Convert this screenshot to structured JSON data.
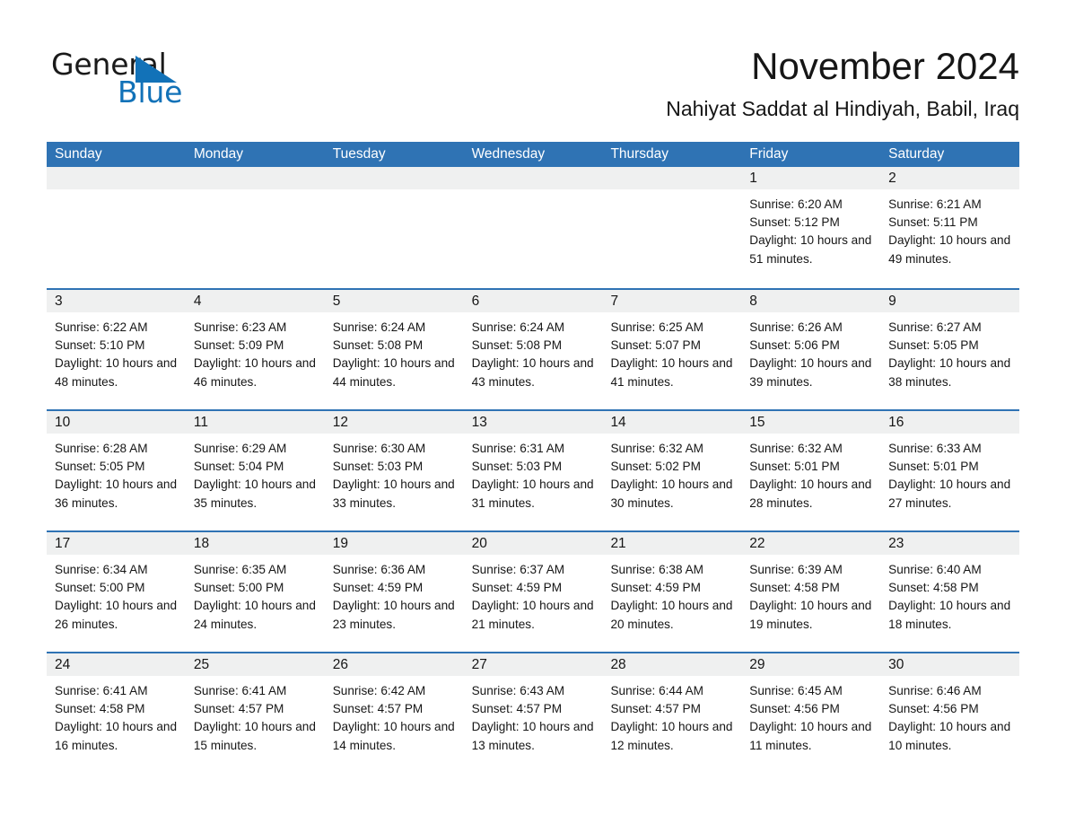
{
  "brand": {
    "name_part1": "General",
    "name_part2": "Blue",
    "triangle_color": "#1272b8"
  },
  "header": {
    "title": "November 2024",
    "subtitle": "Nahiyat Saddat al Hindiyah, Babil, Iraq"
  },
  "theme": {
    "header_blue": "#2f73b4",
    "day_band_gray": "#eff0f0",
    "text_color": "#161616"
  },
  "weekdays": [
    "Sunday",
    "Monday",
    "Tuesday",
    "Wednesday",
    "Thursday",
    "Friday",
    "Saturday"
  ],
  "weeks": [
    [
      {
        "day": "",
        "sunrise": "",
        "sunset": "",
        "daylight": "",
        "empty": true
      },
      {
        "day": "",
        "sunrise": "",
        "sunset": "",
        "daylight": "",
        "empty": true
      },
      {
        "day": "",
        "sunrise": "",
        "sunset": "",
        "daylight": "",
        "empty": true
      },
      {
        "day": "",
        "sunrise": "",
        "sunset": "",
        "daylight": "",
        "empty": true
      },
      {
        "day": "",
        "sunrise": "",
        "sunset": "",
        "daylight": "",
        "empty": true
      },
      {
        "day": "1",
        "sunrise": "Sunrise: 6:20 AM",
        "sunset": "Sunset: 5:12 PM",
        "daylight": "Daylight: 10 hours and 51 minutes."
      },
      {
        "day": "2",
        "sunrise": "Sunrise: 6:21 AM",
        "sunset": "Sunset: 5:11 PM",
        "daylight": "Daylight: 10 hours and 49 minutes."
      }
    ],
    [
      {
        "day": "3",
        "sunrise": "Sunrise: 6:22 AM",
        "sunset": "Sunset: 5:10 PM",
        "daylight": "Daylight: 10 hours and 48 minutes."
      },
      {
        "day": "4",
        "sunrise": "Sunrise: 6:23 AM",
        "sunset": "Sunset: 5:09 PM",
        "daylight": "Daylight: 10 hours and 46 minutes."
      },
      {
        "day": "5",
        "sunrise": "Sunrise: 6:24 AM",
        "sunset": "Sunset: 5:08 PM",
        "daylight": "Daylight: 10 hours and 44 minutes."
      },
      {
        "day": "6",
        "sunrise": "Sunrise: 6:24 AM",
        "sunset": "Sunset: 5:08 PM",
        "daylight": "Daylight: 10 hours and 43 minutes."
      },
      {
        "day": "7",
        "sunrise": "Sunrise: 6:25 AM",
        "sunset": "Sunset: 5:07 PM",
        "daylight": "Daylight: 10 hours and 41 minutes."
      },
      {
        "day": "8",
        "sunrise": "Sunrise: 6:26 AM",
        "sunset": "Sunset: 5:06 PM",
        "daylight": "Daylight: 10 hours and 39 minutes."
      },
      {
        "day": "9",
        "sunrise": "Sunrise: 6:27 AM",
        "sunset": "Sunset: 5:05 PM",
        "daylight": "Daylight: 10 hours and 38 minutes."
      }
    ],
    [
      {
        "day": "10",
        "sunrise": "Sunrise: 6:28 AM",
        "sunset": "Sunset: 5:05 PM",
        "daylight": "Daylight: 10 hours and 36 minutes."
      },
      {
        "day": "11",
        "sunrise": "Sunrise: 6:29 AM",
        "sunset": "Sunset: 5:04 PM",
        "daylight": "Daylight: 10 hours and 35 minutes."
      },
      {
        "day": "12",
        "sunrise": "Sunrise: 6:30 AM",
        "sunset": "Sunset: 5:03 PM",
        "daylight": "Daylight: 10 hours and 33 minutes."
      },
      {
        "day": "13",
        "sunrise": "Sunrise: 6:31 AM",
        "sunset": "Sunset: 5:03 PM",
        "daylight": "Daylight: 10 hours and 31 minutes."
      },
      {
        "day": "14",
        "sunrise": "Sunrise: 6:32 AM",
        "sunset": "Sunset: 5:02 PM",
        "daylight": "Daylight: 10 hours and 30 minutes."
      },
      {
        "day": "15",
        "sunrise": "Sunrise: 6:32 AM",
        "sunset": "Sunset: 5:01 PM",
        "daylight": "Daylight: 10 hours and 28 minutes."
      },
      {
        "day": "16",
        "sunrise": "Sunrise: 6:33 AM",
        "sunset": "Sunset: 5:01 PM",
        "daylight": "Daylight: 10 hours and 27 minutes."
      }
    ],
    [
      {
        "day": "17",
        "sunrise": "Sunrise: 6:34 AM",
        "sunset": "Sunset: 5:00 PM",
        "daylight": "Daylight: 10 hours and 26 minutes."
      },
      {
        "day": "18",
        "sunrise": "Sunrise: 6:35 AM",
        "sunset": "Sunset: 5:00 PM",
        "daylight": "Daylight: 10 hours and 24 minutes."
      },
      {
        "day": "19",
        "sunrise": "Sunrise: 6:36 AM",
        "sunset": "Sunset: 4:59 PM",
        "daylight": "Daylight: 10 hours and 23 minutes."
      },
      {
        "day": "20",
        "sunrise": "Sunrise: 6:37 AM",
        "sunset": "Sunset: 4:59 PM",
        "daylight": "Daylight: 10 hours and 21 minutes."
      },
      {
        "day": "21",
        "sunrise": "Sunrise: 6:38 AM",
        "sunset": "Sunset: 4:59 PM",
        "daylight": "Daylight: 10 hours and 20 minutes."
      },
      {
        "day": "22",
        "sunrise": "Sunrise: 6:39 AM",
        "sunset": "Sunset: 4:58 PM",
        "daylight": "Daylight: 10 hours and 19 minutes."
      },
      {
        "day": "23",
        "sunrise": "Sunrise: 6:40 AM",
        "sunset": "Sunset: 4:58 PM",
        "daylight": "Daylight: 10 hours and 18 minutes."
      }
    ],
    [
      {
        "day": "24",
        "sunrise": "Sunrise: 6:41 AM",
        "sunset": "Sunset: 4:58 PM",
        "daylight": "Daylight: 10 hours and 16 minutes."
      },
      {
        "day": "25",
        "sunrise": "Sunrise: 6:41 AM",
        "sunset": "Sunset: 4:57 PM",
        "daylight": "Daylight: 10 hours and 15 minutes."
      },
      {
        "day": "26",
        "sunrise": "Sunrise: 6:42 AM",
        "sunset": "Sunset: 4:57 PM",
        "daylight": "Daylight: 10 hours and 14 minutes."
      },
      {
        "day": "27",
        "sunrise": "Sunrise: 6:43 AM",
        "sunset": "Sunset: 4:57 PM",
        "daylight": "Daylight: 10 hours and 13 minutes."
      },
      {
        "day": "28",
        "sunrise": "Sunrise: 6:44 AM",
        "sunset": "Sunset: 4:57 PM",
        "daylight": "Daylight: 10 hours and 12 minutes."
      },
      {
        "day": "29",
        "sunrise": "Sunrise: 6:45 AM",
        "sunset": "Sunset: 4:56 PM",
        "daylight": "Daylight: 10 hours and 11 minutes."
      },
      {
        "day": "30",
        "sunrise": "Sunrise: 6:46 AM",
        "sunset": "Sunset: 4:56 PM",
        "daylight": "Daylight: 10 hours and 10 minutes."
      }
    ]
  ]
}
